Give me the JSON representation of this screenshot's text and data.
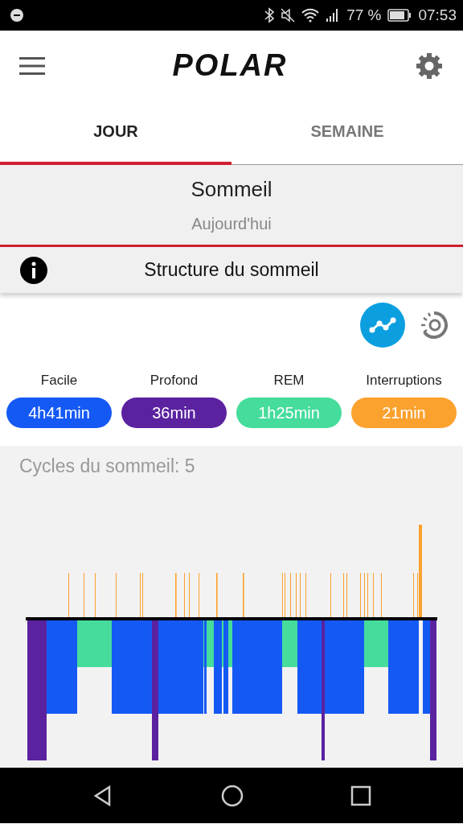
{
  "status_bar": {
    "battery": "77 %",
    "time": "07:53"
  },
  "header": {
    "logo": "POLAR"
  },
  "tabs": [
    {
      "label": "JOUR",
      "selected": true
    },
    {
      "label": "SEMAINE",
      "selected": false
    }
  ],
  "summary": {
    "title": "Sommeil",
    "subtitle": "Aujourd'hui"
  },
  "section_title": "Structure du sommeil",
  "view_toggle": [
    {
      "kind": "graph",
      "selected": true
    },
    {
      "kind": "cycle",
      "selected": false
    }
  ],
  "stages": [
    {
      "label": "Facile",
      "value": "4h41min",
      "color": "#1559f5"
    },
    {
      "label": "Profond",
      "value": "36min",
      "color": "#5b22a0"
    },
    {
      "label": "REM",
      "value": "1h25min",
      "color": "#45dc9c"
    },
    {
      "label": "Interruptions",
      "value": "21min",
      "color": "#fba12e"
    }
  ],
  "hypnogram": {
    "title": "Cycles du sommeil: 5"
  }
}
